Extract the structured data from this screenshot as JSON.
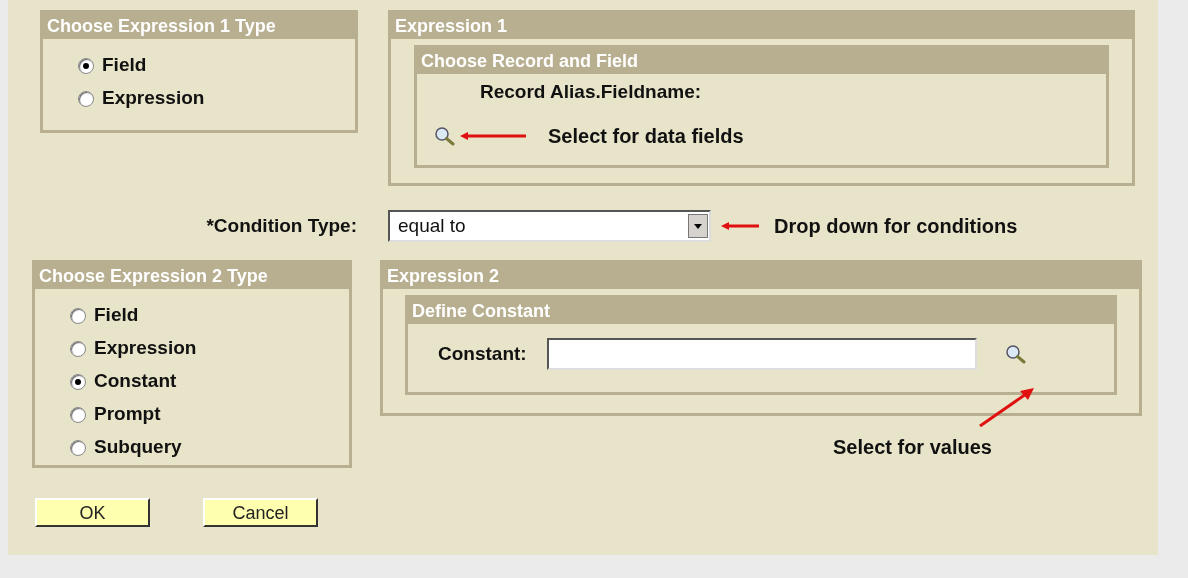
{
  "expression1_type": {
    "title": "Choose Expression 1 Type",
    "options": [
      {
        "label": "Field",
        "selected": true
      },
      {
        "label": "Expression",
        "selected": false
      }
    ]
  },
  "expression1": {
    "title": "Expression 1",
    "section": {
      "title": "Choose Record and Field",
      "label": "Record Alias.Fieldname:"
    },
    "annotation": "Select for data fields"
  },
  "condition": {
    "label": "*Condition Type:",
    "value": "equal to",
    "annotation": "Drop down for conditions"
  },
  "expression2_type": {
    "title": "Choose Expression 2 Type",
    "options": [
      {
        "label": "Field",
        "selected": false
      },
      {
        "label": "Expression",
        "selected": false
      },
      {
        "label": "Constant",
        "selected": true
      },
      {
        "label": "Prompt",
        "selected": false
      },
      {
        "label": "Subquery",
        "selected": false
      }
    ]
  },
  "expression2": {
    "title": "Expression 2",
    "section": {
      "title": "Define Constant",
      "label": "Constant:"
    },
    "annotation": "Select for values"
  },
  "buttons": [
    "OK",
    "Cancel"
  ]
}
